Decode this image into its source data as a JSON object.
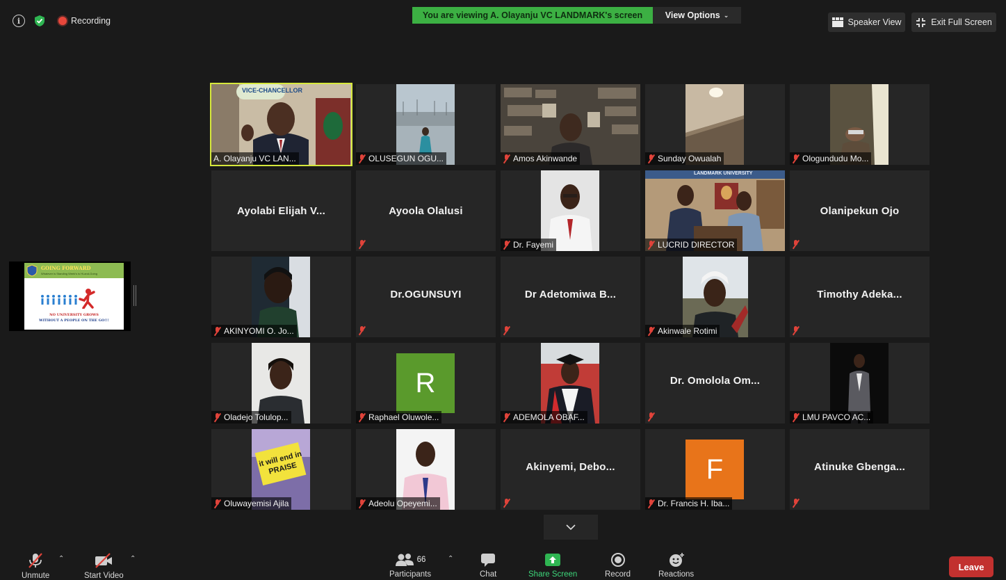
{
  "topbar": {
    "recording_label": "Recording",
    "viewing_banner": "You are viewing A. Olayanju VC LANDMARK's screen",
    "view_options": "View Options",
    "speaker_view": "Speaker View",
    "exit_full_screen": "Exit Full Screen"
  },
  "shared_screen": {
    "title": "GOING FORWARD",
    "subtitle": "Whatever is Standing Week's is Hi-and-Going",
    "line1": "NO UNIVERSITY GROWS",
    "line2": "WITHOUT A PEOPLE ON THE GO!!!"
  },
  "tiles": {
    "t00": "A. Olayanju VC LAN...",
    "t01": "OLUSEGUN OGU...",
    "t02": "Amos Akinwande",
    "t03": "Sunday Owualah",
    "t04": "Ologundudu Mo...",
    "t10": "Ayolabi Elijah V...",
    "t11": "Ayoola Olalusi",
    "t12": "Dr. Fayemi",
    "t13": "LUCRID DIRECTOR",
    "t14": "Olanipekun Ojo",
    "t20": "AKINYOMI O. Jo...",
    "t21": "Dr.OGUNSUYI",
    "t22": "Dr Adetomiwa B...",
    "t23": "Akinwale Rotimi",
    "t24": "Timothy Adeka...",
    "t30": "Oladejo Tolulop...",
    "t31": "Raphael Oluwole...",
    "t31_letter": "R",
    "t32": "ADEMOLA OBAF...",
    "t33": "Dr. Omolola Om...",
    "t34": "LMU PAVCO AC...",
    "t40": "Oluwayemisi Ajila",
    "t41": "Adeolu Opeyemi...",
    "t42": "Akinyemi, Debo...",
    "t43": "Dr. Francis H. Iba...",
    "t43_letter": "F",
    "t44": "Atinuke Gbenga...",
    "sticky_note": "it will end in PRAISE",
    "vc_banner": "VICE-CHANCELLOR",
    "univ_banner": "LANDMARK UNIVERSITY"
  },
  "toolbar": {
    "unmute": "Unmute",
    "start_video": "Start Video",
    "participants": "Participants",
    "participants_count": "66",
    "chat": "Chat",
    "share_screen": "Share Screen",
    "record": "Record",
    "reactions": "Reactions",
    "leave": "Leave"
  },
  "colors": {
    "banner_green": "#3cb043",
    "active_speaker": "#d6e83c",
    "muted_red": "#e0433a",
    "leave_red": "#c2312f",
    "share_green": "#3dd67a"
  }
}
